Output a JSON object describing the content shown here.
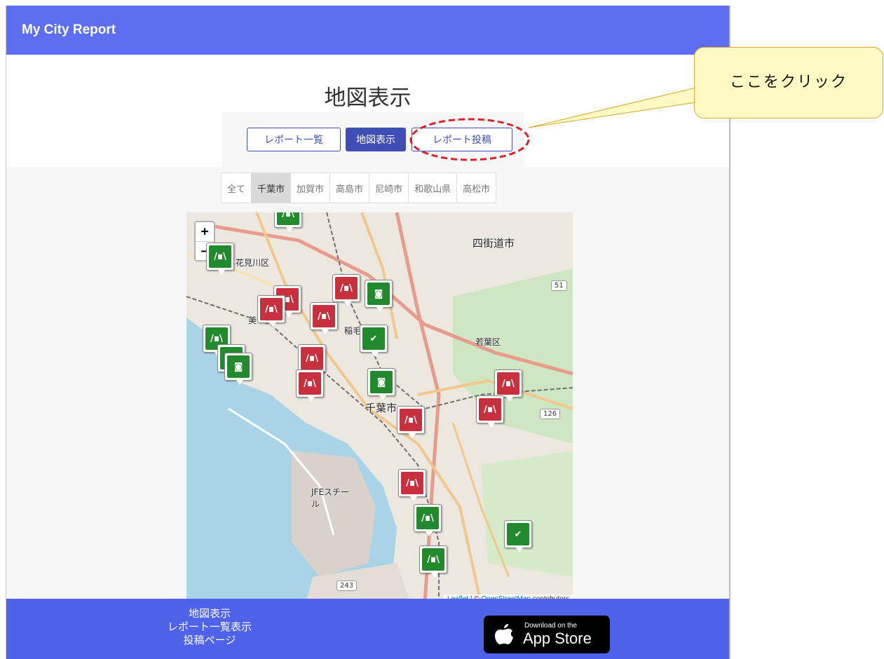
{
  "navbar": {
    "brand": "My City Report"
  },
  "page": {
    "title": "地図表示"
  },
  "tabs": [
    {
      "label": "レポート一覧",
      "active": false
    },
    {
      "label": "地図表示",
      "active": true
    },
    {
      "label": "レポート投稿",
      "active": false
    }
  ],
  "cities": [
    {
      "label": "全て",
      "active": false
    },
    {
      "label": "千葉市",
      "active": true
    },
    {
      "label": "加賀市",
      "active": false
    },
    {
      "label": "高島市",
      "active": false
    },
    {
      "label": "尼崎市",
      "active": false
    },
    {
      "label": "和歌山県",
      "active": false
    },
    {
      "label": "高松市",
      "active": false
    }
  ],
  "map": {
    "zoom_in": "+",
    "zoom_out": "−",
    "labels": {
      "yotsukaido": "四街道市",
      "hanamigawa": "花見川区",
      "wakaba": "若葉区",
      "chiba": "千葉市",
      "inage": "稲毛",
      "mi": "美",
      "jfe": "JFEスチール"
    },
    "routes": {
      "r51": "51",
      "r126": "126",
      "r243": "243"
    },
    "attribution": {
      "leaflet": "Leaflet",
      "sep": " | © ",
      "osm": "OpenStreetMap",
      "contrib": " contributors"
    },
    "marker_types": {
      "road": "road-damage-icon",
      "photo": "camera-icon",
      "done": "check-icon"
    }
  },
  "footer": {
    "links": [
      "地図表示",
      "レポート一覧表示",
      "投稿ページ"
    ],
    "appstore_small": "Download on the",
    "appstore_big": "App Store"
  },
  "callout": {
    "text": "ここをクリック"
  },
  "colors": {
    "navbar": "#5e6ef3",
    "primary": "#3f4fb5",
    "marker_red": "#c9303d",
    "marker_green": "#218a2c",
    "highlight": "#e0202a",
    "callout_bg": "#fff9c4"
  }
}
